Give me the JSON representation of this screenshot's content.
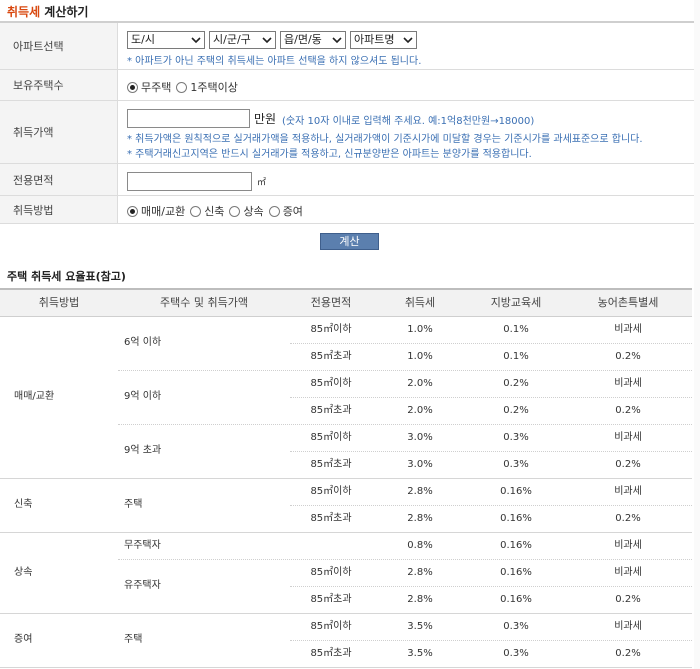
{
  "header": {
    "title_highlight": "취득세",
    "title_rest": " 계산하기"
  },
  "form": {
    "apartment": {
      "label": "아파트선택",
      "selects": [
        "도/시",
        "시/군/구",
        "읍/면/동",
        "아파트명"
      ],
      "note": "* 아파트가 아닌 주택의 취득세는 아파트 선택을 하지 않으셔도 됩니다."
    },
    "houses": {
      "label": "보유주택수",
      "options": [
        "무주택",
        "1주택이상"
      ],
      "selected": 0
    },
    "price": {
      "label": "취득가액",
      "value": "",
      "unit": "만원",
      "hint": "(숫자 10자 이내로 입력해 주세요. 예:1억8천만원→18000)",
      "note1": "* 취득가액은 원칙적으로 실거래가액을 적용하나, 실거래가액이 기준시가에 미달할 경우는 기준시가를 과세표준으로 합니다.",
      "note2": "* 주택거래신고지역은 반드시 실거래가를 적용하고, 신규분양받은 아파트는 분양가를 적용합니다."
    },
    "area": {
      "label": "전용면적",
      "value": "",
      "unit": "㎡"
    },
    "method": {
      "label": "취득방법",
      "options": [
        "매매/교환",
        "신축",
        "상속",
        "증여"
      ],
      "selected": 0
    },
    "calc_button": "계산"
  },
  "rates": {
    "title": "주택 취득세 요율표(참고)",
    "headers": [
      "취득방법",
      "주택수 및 취득가액",
      "전용면적",
      "취득세",
      "지방교육세",
      "농어촌특별세"
    ],
    "groups": [
      {
        "method": "매매/교환",
        "subgroups": [
          {
            "label": "6억 이하",
            "rows": [
              {
                "area": "85㎡이하",
                "tax": "1.0%",
                "edu": "0.1%",
                "rural": "비과세"
              },
              {
                "area": "85㎡초과",
                "tax": "1.0%",
                "edu": "0.1%",
                "rural": "0.2%"
              }
            ]
          },
          {
            "label": "9억 이하",
            "rows": [
              {
                "area": "85㎡이하",
                "tax": "2.0%",
                "edu": "0.2%",
                "rural": "비과세"
              },
              {
                "area": "85㎡초과",
                "tax": "2.0%",
                "edu": "0.2%",
                "rural": "0.2%"
              }
            ]
          },
          {
            "label": "9억 초과",
            "rows": [
              {
                "area": "85㎡이하",
                "tax": "3.0%",
                "edu": "0.3%",
                "rural": "비과세"
              },
              {
                "area": "85㎡초과",
                "tax": "3.0%",
                "edu": "0.3%",
                "rural": "0.2%"
              }
            ]
          }
        ]
      },
      {
        "method": "신축",
        "subgroups": [
          {
            "label": "주택",
            "rows": [
              {
                "area": "85㎡이하",
                "tax": "2.8%",
                "edu": "0.16%",
                "rural": "비과세"
              },
              {
                "area": "85㎡초과",
                "tax": "2.8%",
                "edu": "0.16%",
                "rural": "0.2%"
              }
            ]
          }
        ]
      },
      {
        "method": "상속",
        "subgroups": [
          {
            "label": "무주택자",
            "rows": [
              {
                "area": "",
                "tax": "0.8%",
                "edu": "0.16%",
                "rural": "비과세"
              }
            ]
          },
          {
            "label": "유주택자",
            "rows": [
              {
                "area": "85㎡이하",
                "tax": "2.8%",
                "edu": "0.16%",
                "rural": "비과세"
              },
              {
                "area": "85㎡초과",
                "tax": "2.8%",
                "edu": "0.16%",
                "rural": "0.2%"
              }
            ]
          }
        ]
      },
      {
        "method": "증여",
        "subgroups": [
          {
            "label": "주택",
            "rows": [
              {
                "area": "85㎡이하",
                "tax": "3.5%",
                "edu": "0.3%",
                "rural": "비과세"
              },
              {
                "area": "85㎡초과",
                "tax": "3.5%",
                "edu": "0.3%",
                "rural": "0.2%"
              }
            ]
          }
        ]
      }
    ]
  }
}
